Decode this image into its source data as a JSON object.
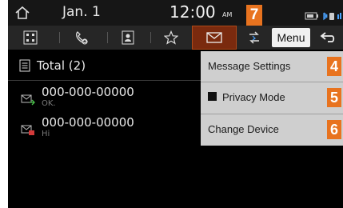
{
  "status_bar": {
    "date": "Jan. 1",
    "time": "12:00",
    "ampm": "AM",
    "icons": [
      "home-icon",
      "battery-icon",
      "bluetooth-phone-icon"
    ]
  },
  "toolbar": {
    "icons": [
      "dial-pad-icon",
      "call-history-icon",
      "contacts-icon",
      "favorites-star-icon",
      "messages-envelope-icon",
      "switch-device-icon",
      "back-icon"
    ],
    "active": "messages-envelope-icon",
    "menu_label": "Menu",
    "callout": "7"
  },
  "messages": {
    "header": "Total (2)",
    "items": [
      {
        "number": "000-000-00000",
        "preview": "OK.",
        "icon": "sent-message-icon"
      },
      {
        "number": "000-000-00000",
        "preview": "Hi",
        "icon": "received-message-icon"
      }
    ]
  },
  "menu": {
    "items": [
      {
        "label": "Message Settings",
        "callout": "4"
      },
      {
        "label": "Privacy Mode",
        "callout": "5",
        "checked": false
      },
      {
        "label": "Change Device",
        "callout": "6"
      }
    ]
  },
  "colors": {
    "callout": "#e8731f",
    "screen_bg": "#000000",
    "menu_bg": "#cfcfcf",
    "active_tab": "#7a2a0e"
  }
}
